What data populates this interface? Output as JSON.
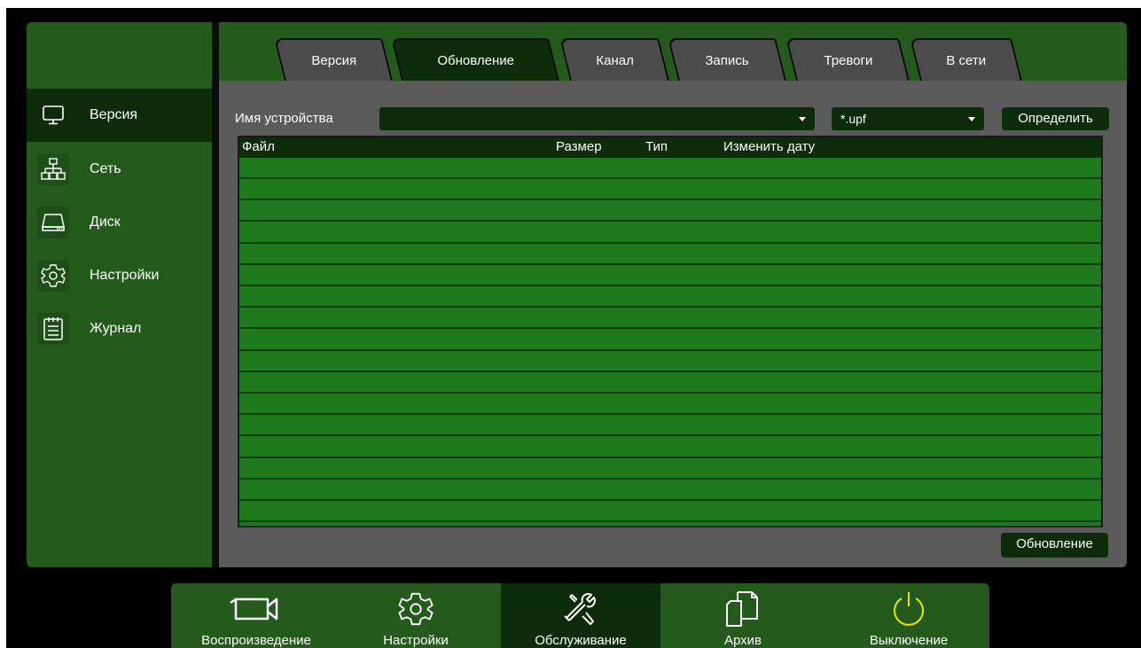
{
  "sidebar": {
    "items": [
      {
        "label": "Версия",
        "icon": "monitor-icon"
      },
      {
        "label": "Сеть",
        "icon": "network-icon"
      },
      {
        "label": "Диск",
        "icon": "disk-icon"
      },
      {
        "label": "Настройки",
        "icon": "gear-icon"
      },
      {
        "label": "Журнал",
        "icon": "log-icon"
      }
    ],
    "active": "Версия"
  },
  "tabs": [
    {
      "label": "Версия"
    },
    {
      "label": "Обновление"
    },
    {
      "label": "Канал"
    },
    {
      "label": "Запись"
    },
    {
      "label": "Тревоги"
    },
    {
      "label": "В сети"
    }
  ],
  "active_tab": "Обновление",
  "update": {
    "device_label": "Имя устройства",
    "device_value": "",
    "filter_value": "*.upf",
    "detect_button": "Определить",
    "columns": {
      "file": "Файл",
      "size": "Размер",
      "type": "Тип",
      "date": "Изменить дату"
    },
    "update_button": "Обновление"
  },
  "dock": {
    "items": [
      {
        "label": "Воспроизведение",
        "icon": "camera-icon"
      },
      {
        "label": "Настройки",
        "icon": "gear-icon"
      },
      {
        "label": "Обслуживание",
        "icon": "tools-icon"
      },
      {
        "label": "Архив",
        "icon": "files-icon"
      },
      {
        "label": "Выключение",
        "icon": "power-icon"
      }
    ],
    "active": "Обслуживание"
  },
  "colors": {
    "panel_green": "#245b1d",
    "dark_green": "#0d2c0a",
    "table_green": "#1f7a1e",
    "gray": "#5b5b5b",
    "power_yellow": "#e8e800"
  }
}
